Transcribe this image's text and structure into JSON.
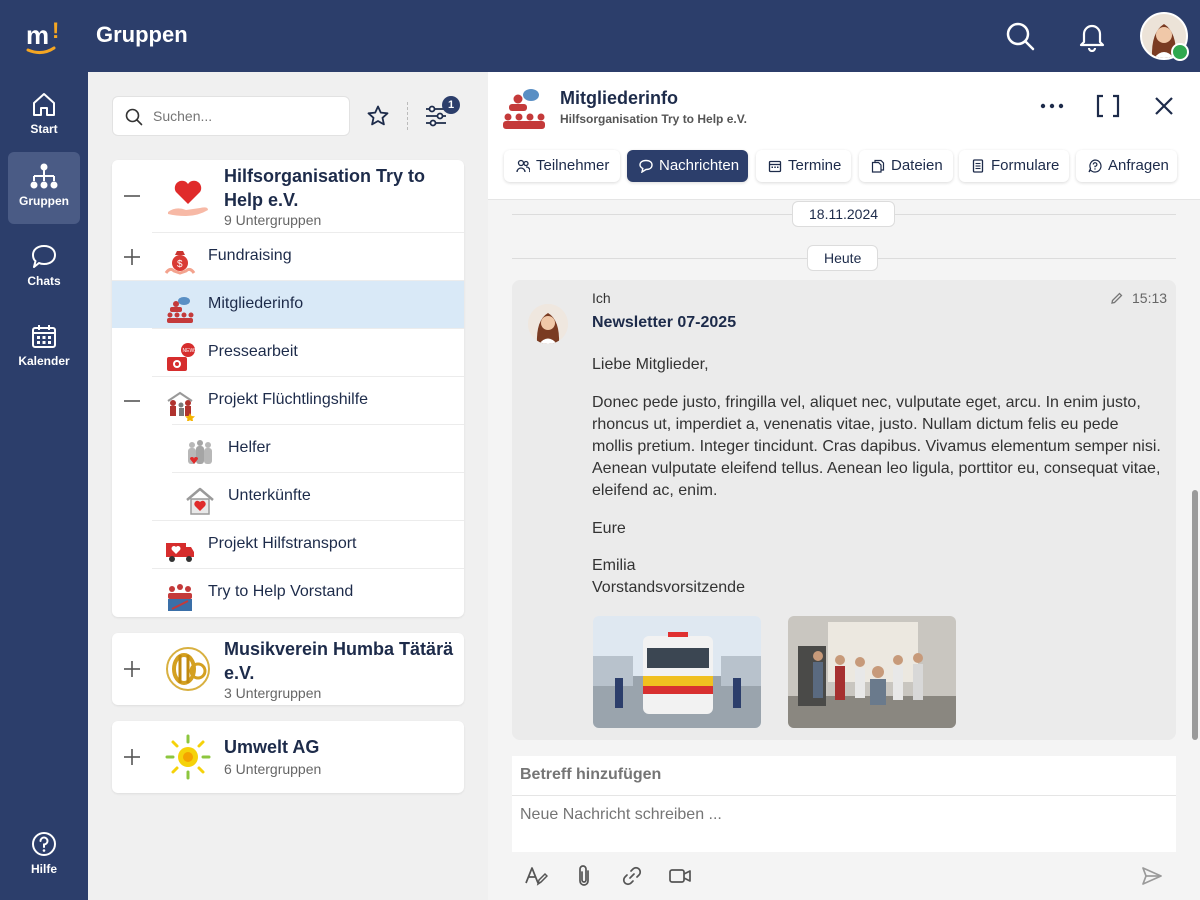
{
  "header": {
    "title": "Gruppen"
  },
  "nav": {
    "items": [
      {
        "label": "Start"
      },
      {
        "label": "Gruppen"
      },
      {
        "label": "Chats"
      },
      {
        "label": "Kalender"
      }
    ],
    "help_label": "Hilfe"
  },
  "groups": {
    "search_placeholder": "Suchen...",
    "filter_count": "1",
    "cards": [
      {
        "title": "Hilfsorganisation Try to Help e.V.",
        "subtitle": "9 Untergruppen",
        "subgroups": [
          {
            "label": "Fundraising"
          },
          {
            "label": "Mitgliederinfo"
          },
          {
            "label": "Pressearbeit"
          },
          {
            "label": "Projekt Flüchtlingshilfe"
          },
          {
            "label": "Helfer"
          },
          {
            "label": "Unterkünfte"
          },
          {
            "label": "Projekt Hilfstransport"
          },
          {
            "label": "Try to Help Vorstand"
          }
        ]
      },
      {
        "title": "Musikverein Humba Tätärä e.V.",
        "subtitle": "3 Untergruppen"
      },
      {
        "title": "Umwelt AG",
        "subtitle": "6 Untergruppen"
      }
    ]
  },
  "detail": {
    "title": "Mitgliederinfo",
    "subtitle": "Hilfsorganisation Try to Help e.V.",
    "tabs": [
      {
        "label": "Teilnehmer",
        "icon": "users-icon"
      },
      {
        "label": "Nachrichten",
        "icon": "chat-bubble-icon"
      },
      {
        "label": "Termine",
        "icon": "calendar-icon"
      },
      {
        "label": "Dateien",
        "icon": "files-icon"
      },
      {
        "label": "Formulare",
        "icon": "form-icon"
      },
      {
        "label": "Anfragen",
        "icon": "question-icon"
      }
    ],
    "dates": [
      "18.11.2024",
      "Heute"
    ],
    "message": {
      "sender": "Ich",
      "time": "15:13",
      "subject": "Newsletter 07-2025",
      "greeting": "Liebe Mitglieder,",
      "body": "Donec pede justo, fringilla vel, aliquet nec, vulputate eget, arcu. In enim justo, rhoncus ut, imperdiet a, venenatis vitae, justo. Nullam dictum felis eu pede mollis pretium. Integer tincidunt. Cras dapibus. Vivamus elementum semper nisi. Aenean vulputate eleifend tellus. Aenean leo ligula, porttitor eu, consequat vitae, eleifend ac, enim.",
      "closing": "Eure",
      "signature_name": "Emilia",
      "signature_role": "Vorstandsvorsitzende"
    },
    "compose": {
      "subject_placeholder": "Betreff hinzufügen",
      "body_placeholder": "Neue Nachricht schreiben ..."
    }
  },
  "colors": {
    "primary": "#2c3e6b",
    "selected_row": "#d9e9f7",
    "online": "#2fa84f",
    "brand_accent": "#f5a623"
  }
}
